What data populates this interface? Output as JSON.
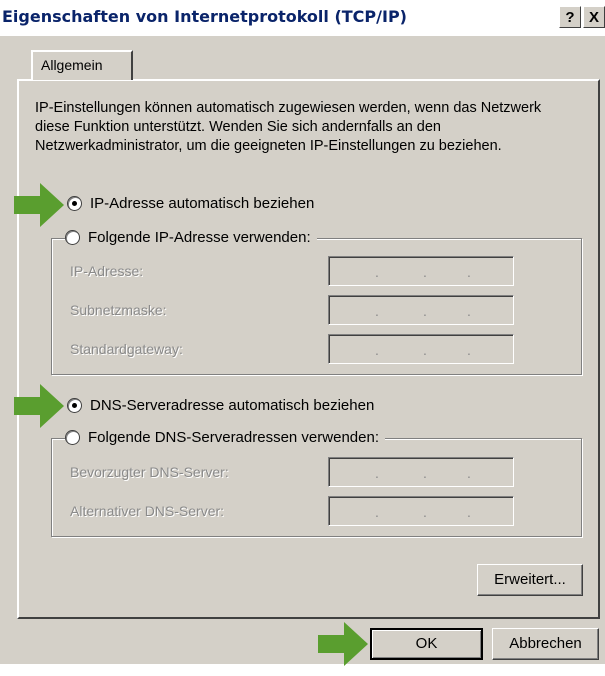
{
  "window": {
    "title": "Eigenschaften von Internetprotokoll (TCP/IP)",
    "help_label": "?",
    "close_label": "X"
  },
  "tabs": [
    {
      "label": "Allgemein"
    }
  ],
  "description": "IP-Einstellungen können automatisch zugewiesen werden, wenn das Netzwerk diese Funktion unterstützt. Wenden Sie sich andernfalls an den Netzwerkadministrator, um die geeigneten IP-Einstellungen zu beziehen.",
  "ip_section": {
    "auto_label": "IP-Adresse automatisch beziehen",
    "auto_selected": true,
    "manual_label": "Folgende IP-Adresse verwenden:",
    "fields": [
      {
        "label": "IP-Adresse:",
        "value": ". . ."
      },
      {
        "label": "Subnetzmaske:",
        "value": ". . ."
      },
      {
        "label": "Standardgateway:",
        "value": ". . ."
      }
    ]
  },
  "dns_section": {
    "auto_label": "DNS-Serveradresse automatisch beziehen",
    "auto_selected": true,
    "manual_label": "Folgende DNS-Serveradressen verwenden:",
    "fields": [
      {
        "label": "Bevorzugter DNS-Server:",
        "value": ". . ."
      },
      {
        "label": "Alternativer DNS-Server:",
        "value": ". . ."
      }
    ]
  },
  "buttons": {
    "advanced": "Erweitert...",
    "ok": "OK",
    "cancel": "Abbrechen"
  },
  "annotation_color": "#5a9e2f",
  "icons": [
    "arrow-right-icon",
    "radio-icon"
  ]
}
